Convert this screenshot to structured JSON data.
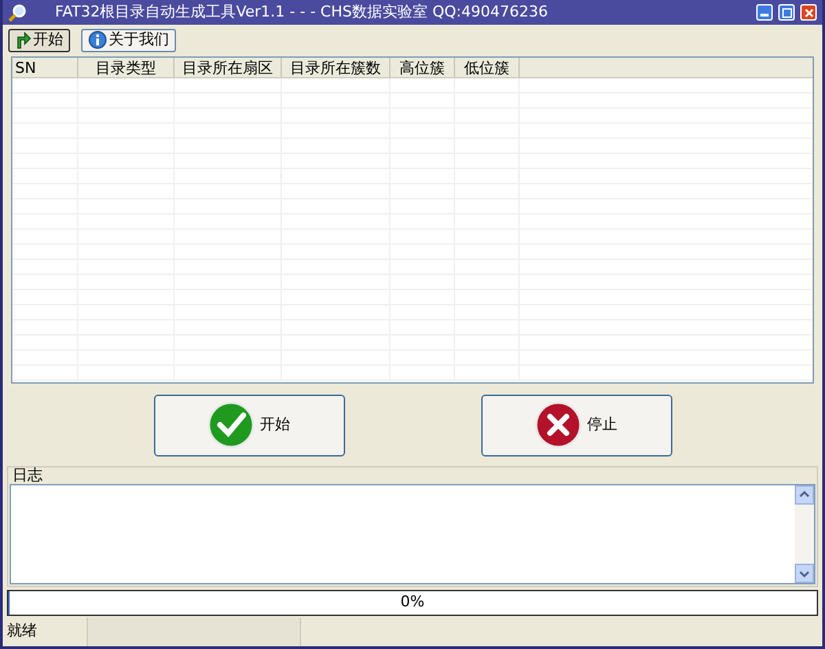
{
  "window": {
    "title": "FAT32根目录自动生成工具Ver1.1 - - - CHS数据实验室 QQ:490476236"
  },
  "toolbar": [
    {
      "kind": "start",
      "label": "开始"
    },
    {
      "kind": "info",
      "label": "关于我们"
    }
  ],
  "table": {
    "columns": [
      "SN",
      "目录类型",
      "目录所在扇区",
      "目录所在簇数",
      "高位簇",
      "低位簇"
    ]
  },
  "actions": [
    {
      "kind": "ok",
      "label": "开始"
    },
    {
      "kind": "stop",
      "label": "停止"
    }
  ],
  "log": {
    "title": "日志"
  },
  "progress": {
    "level": 0,
    "reading": "0%"
  },
  "status_bar": [
    "就绪"
  ]
}
